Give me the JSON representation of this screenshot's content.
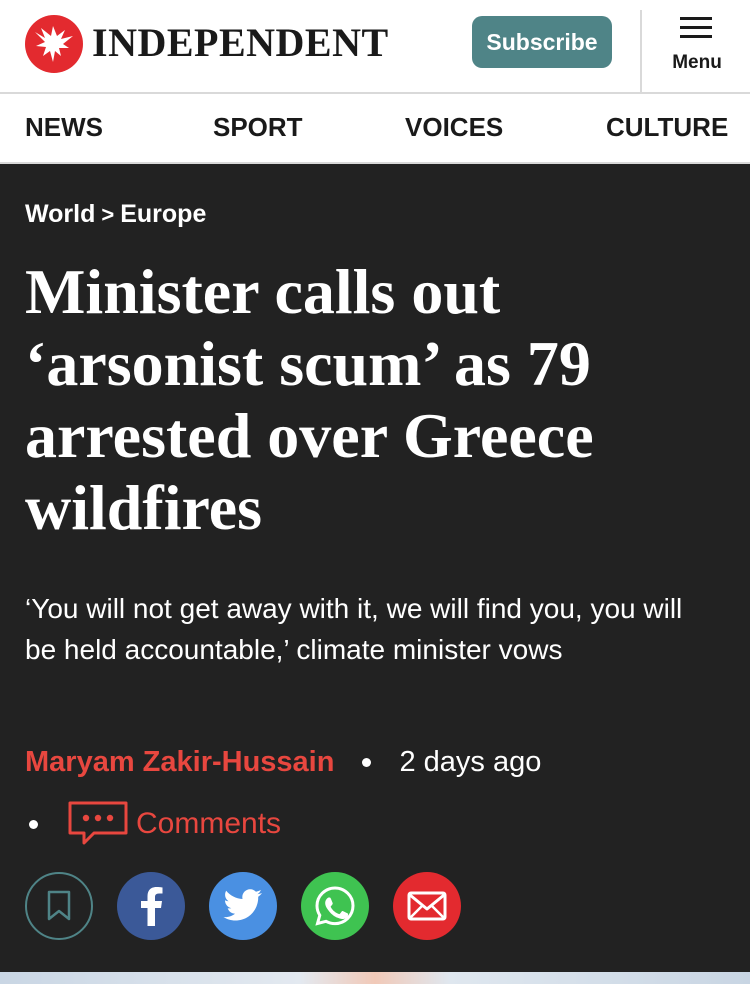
{
  "header": {
    "logo_text": "INDEPENDENT",
    "subscribe_label": "Subscribe",
    "menu_label": "Menu"
  },
  "nav": {
    "items": [
      {
        "label": "NEWS"
      },
      {
        "label": "SPORT"
      },
      {
        "label": "VOICES"
      },
      {
        "label": "CULTURE"
      }
    ]
  },
  "breadcrumb": {
    "items": [
      "World",
      "Europe"
    ],
    "separator": ">"
  },
  "article": {
    "headline": "Minister calls out ‘arsonist scum’ as 79 arrested over Greece wildfires",
    "standfirst": "‘You will not get away with it, we will find you, you will be held accountable,’ climate minister vows",
    "author": "Maryam Zakir-Hussain",
    "published": "2 days ago",
    "comments_label": "Comments"
  },
  "share": {
    "buttons": [
      {
        "icon": "bookmark-icon"
      },
      {
        "icon": "facebook-icon"
      },
      {
        "icon": "twitter-icon"
      },
      {
        "icon": "whatsapp-icon"
      },
      {
        "icon": "email-icon"
      }
    ]
  },
  "colors": {
    "brand_red": "#e32a2f",
    "subscribe_teal": "#4f8487",
    "hero_background": "#222222",
    "author_red": "#e8473f",
    "facebook": "#3b5998",
    "twitter": "#4a90e2",
    "whatsapp": "#3fc351"
  }
}
